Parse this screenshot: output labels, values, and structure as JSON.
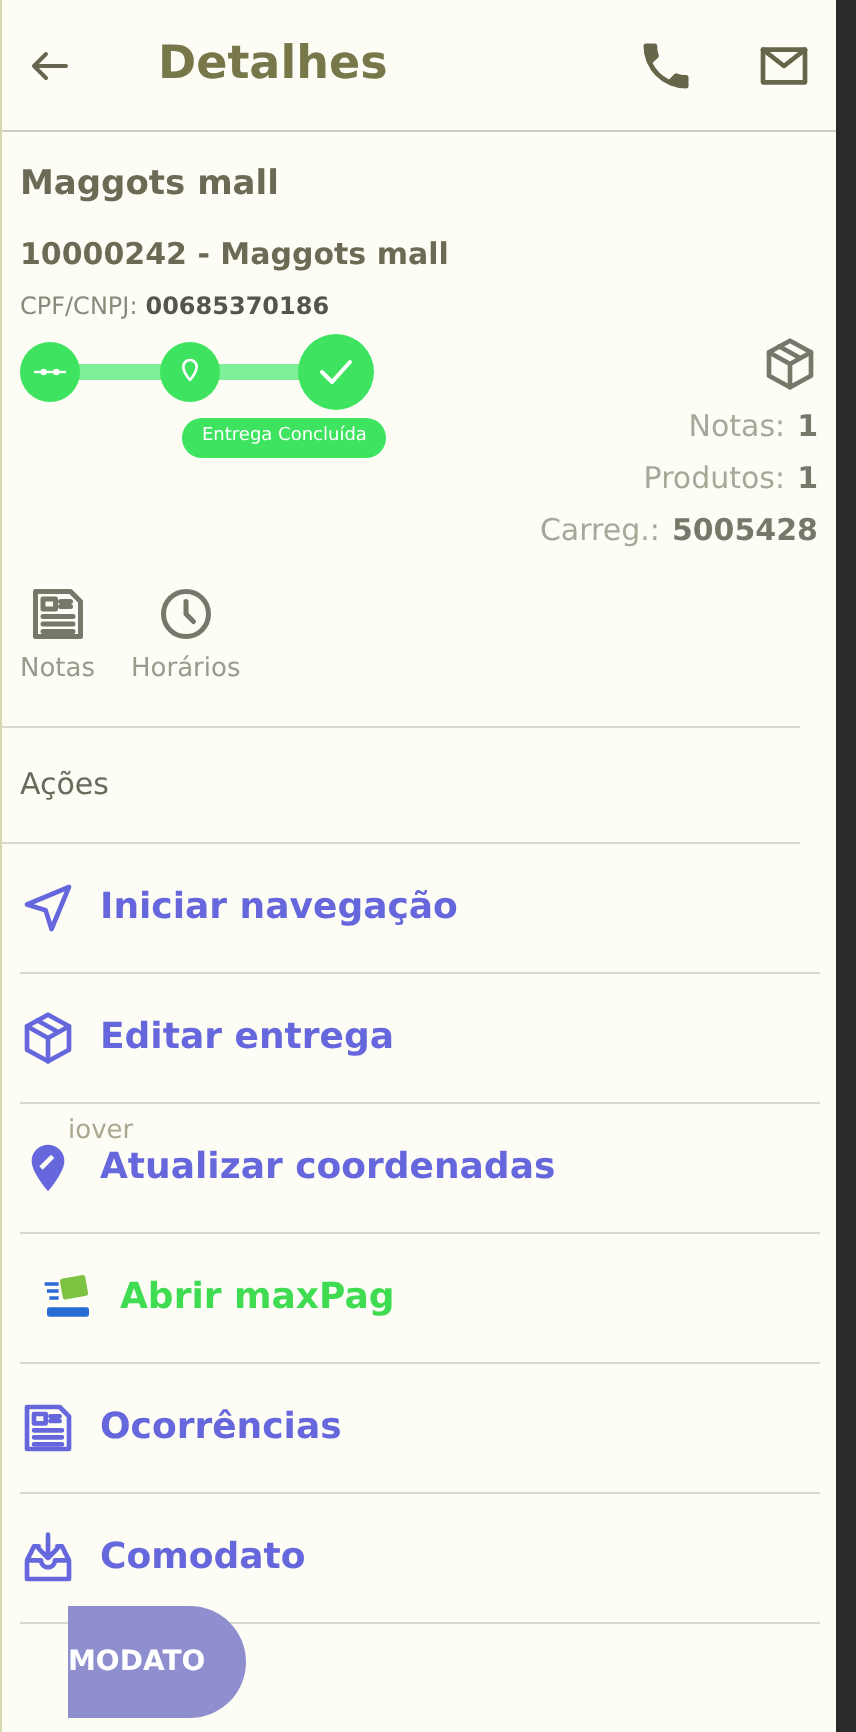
{
  "header": {
    "title": "Detalhes"
  },
  "client": {
    "name": "Maggots mall",
    "code_line": "10000242 - Maggots mall",
    "doc_label": "CPF/CNPJ:",
    "doc_value": "00685370186"
  },
  "stepper": {
    "steps": [
      {
        "kind": "route",
        "done": true
      },
      {
        "kind": "pin",
        "done": true
      },
      {
        "kind": "check",
        "done": true
      }
    ],
    "status_label": "Entrega Concluída"
  },
  "stats": [
    {
      "label": "Notas:",
      "value": "1"
    },
    {
      "label": "Produtos:",
      "value": "1"
    },
    {
      "label": "Carreg.:",
      "value": "5005428"
    }
  ],
  "shortcuts": [
    {
      "kind": "doc",
      "label": "Notas"
    },
    {
      "kind": "clock",
      "label": "Horários"
    }
  ],
  "actions_title": "Ações",
  "actions": [
    {
      "kind": "navigate",
      "label": "Iniciar navegação",
      "color": "#6767dd"
    },
    {
      "kind": "box",
      "label": "Editar entrega",
      "color": "#6767dd"
    },
    {
      "kind": "pin",
      "label": "Atualizar coordenadas",
      "color": "#6767dd"
    },
    {
      "kind": "maxpag",
      "label": "Abrir maxPag",
      "color": "#3fdc52"
    },
    {
      "kind": "doc",
      "label": "Ocorrências",
      "color": "#6767dd"
    },
    {
      "kind": "inbox",
      "label": "Comodato",
      "color": "#6767dd"
    }
  ],
  "ghost_label": "iover",
  "floating_button": {
    "label": "MODATO"
  }
}
